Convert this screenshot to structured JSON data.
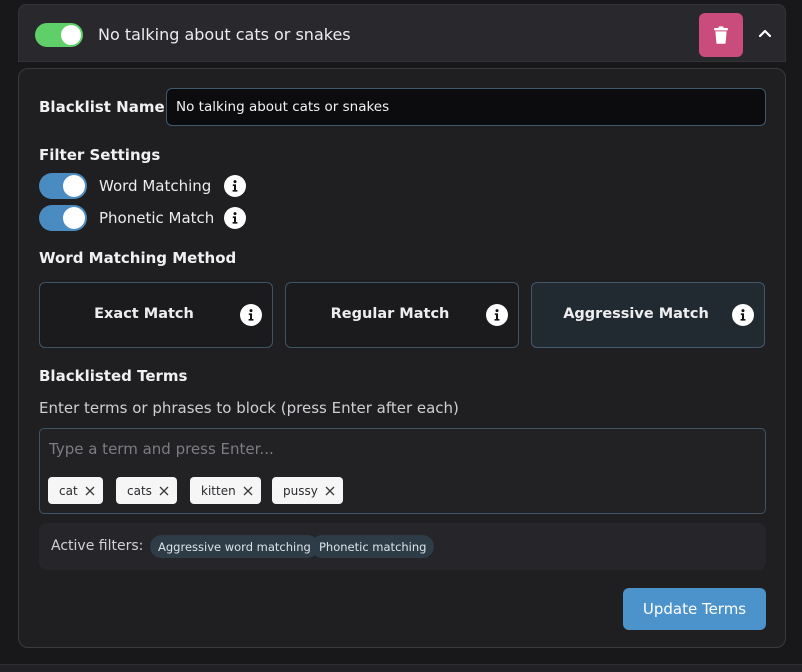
{
  "header": {
    "enabled": true,
    "title": "No talking about cats or snakes"
  },
  "form": {
    "name_label": "Blacklist Name:",
    "name_value": "No talking about cats or snakes",
    "filter_settings_label": "Filter Settings",
    "toggles": [
      {
        "label": "Word Matching",
        "on": true
      },
      {
        "label": "Phonetic Match",
        "on": true
      }
    ],
    "method_label": "Word Matching Method",
    "methods": [
      {
        "label": "Exact Match",
        "selected": false
      },
      {
        "label": "Regular Match",
        "selected": false
      },
      {
        "label": "Aggressive Match",
        "selected": true
      }
    ],
    "terms_label": "Blacklisted Terms",
    "terms_hint": "Enter terms or phrases to block (press Enter after each)",
    "terms_placeholder": "Type a term and press Enter...",
    "terms": [
      "cat",
      "cats",
      "kitten",
      "pussy"
    ],
    "active_filters_label": "Active filters:",
    "active_filters": [
      "Aggressive word matching",
      "Phonetic matching"
    ],
    "update_label": "Update Terms"
  },
  "colors": {
    "accent": "#4c93cc",
    "toggle_on": "#5fcf6a",
    "delete": "#c94c7c"
  }
}
